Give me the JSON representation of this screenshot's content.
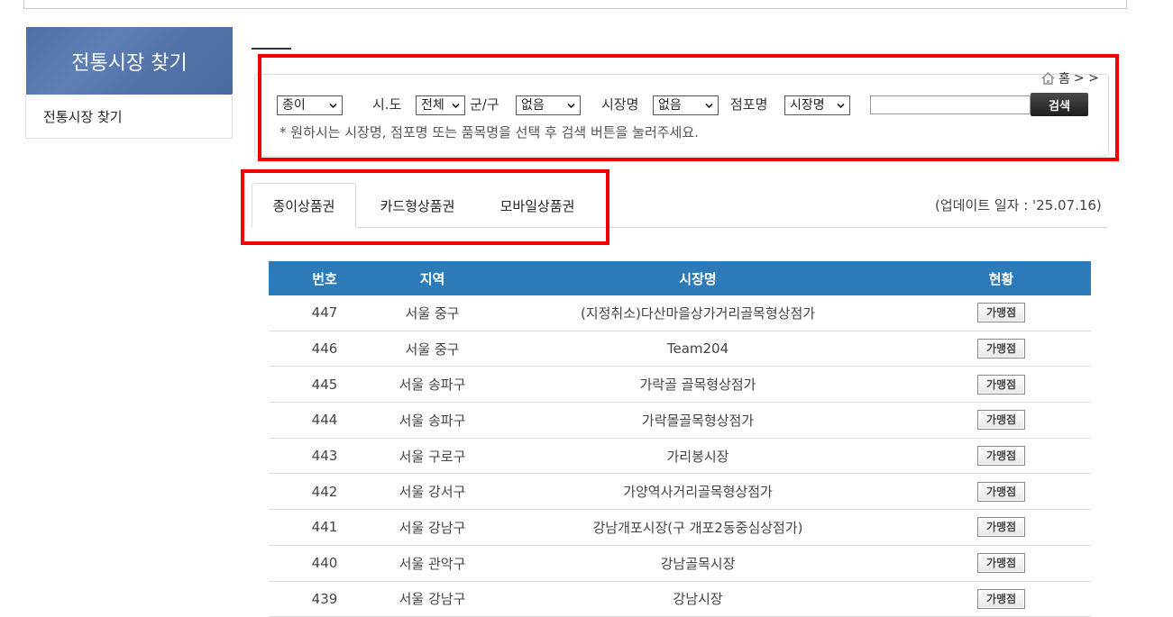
{
  "sidebar": {
    "title": "전통시장 찾기",
    "menu_item": "전통시장 찾기"
  },
  "breadcrumb": {
    "home": "홈",
    "arrows": "> >"
  },
  "search": {
    "type_select": "종이",
    "sido_label": "시.도",
    "sido_select": "전체",
    "gungu_label": "군/구",
    "gungu_select": "없음",
    "market_label": "시장명",
    "market_select": "없음",
    "store_label": "점포명",
    "store_select": "시장명",
    "text_value": "",
    "button": "검색",
    "note": "* 원하시는 시장명, 점포명 또는 품목명을 선택 후 검색 버튼을 눌러주세요."
  },
  "tabs": [
    {
      "label": "종이상품권",
      "active": true
    },
    {
      "label": "카드형상품권",
      "active": false
    },
    {
      "label": "모바일상품권",
      "active": false
    }
  ],
  "update_text": "(업데이트 일자 : '25.07.16)",
  "table": {
    "headers": [
      "번호",
      "지역",
      "시장명",
      "현황"
    ],
    "status_label": "가맹점",
    "rows": [
      {
        "no": "447",
        "region": "서울 중구",
        "name": "(지정취소)다산마을상가거리골목형상점가"
      },
      {
        "no": "446",
        "region": "서울 중구",
        "name": "Team204"
      },
      {
        "no": "445",
        "region": "서울 송파구",
        "name": "가락골 골목형상점가"
      },
      {
        "no": "444",
        "region": "서울 송파구",
        "name": "가락몰골목형상점가"
      },
      {
        "no": "443",
        "region": "서울 구로구",
        "name": "가리봉시장"
      },
      {
        "no": "442",
        "region": "서울 강서구",
        "name": "가양역사거리골목형상점가"
      },
      {
        "no": "441",
        "region": "서울 강남구",
        "name": "강남개포시장(구 개포2동중심상점가)"
      },
      {
        "no": "440",
        "region": "서울 관악구",
        "name": "강남골목시장"
      },
      {
        "no": "439",
        "region": "서울 강남구",
        "name": "강남시장"
      }
    ]
  },
  "colors": {
    "table_header": "#2d7ab8",
    "highlight": "#f00000",
    "sidebar_header": "#5373aa"
  }
}
